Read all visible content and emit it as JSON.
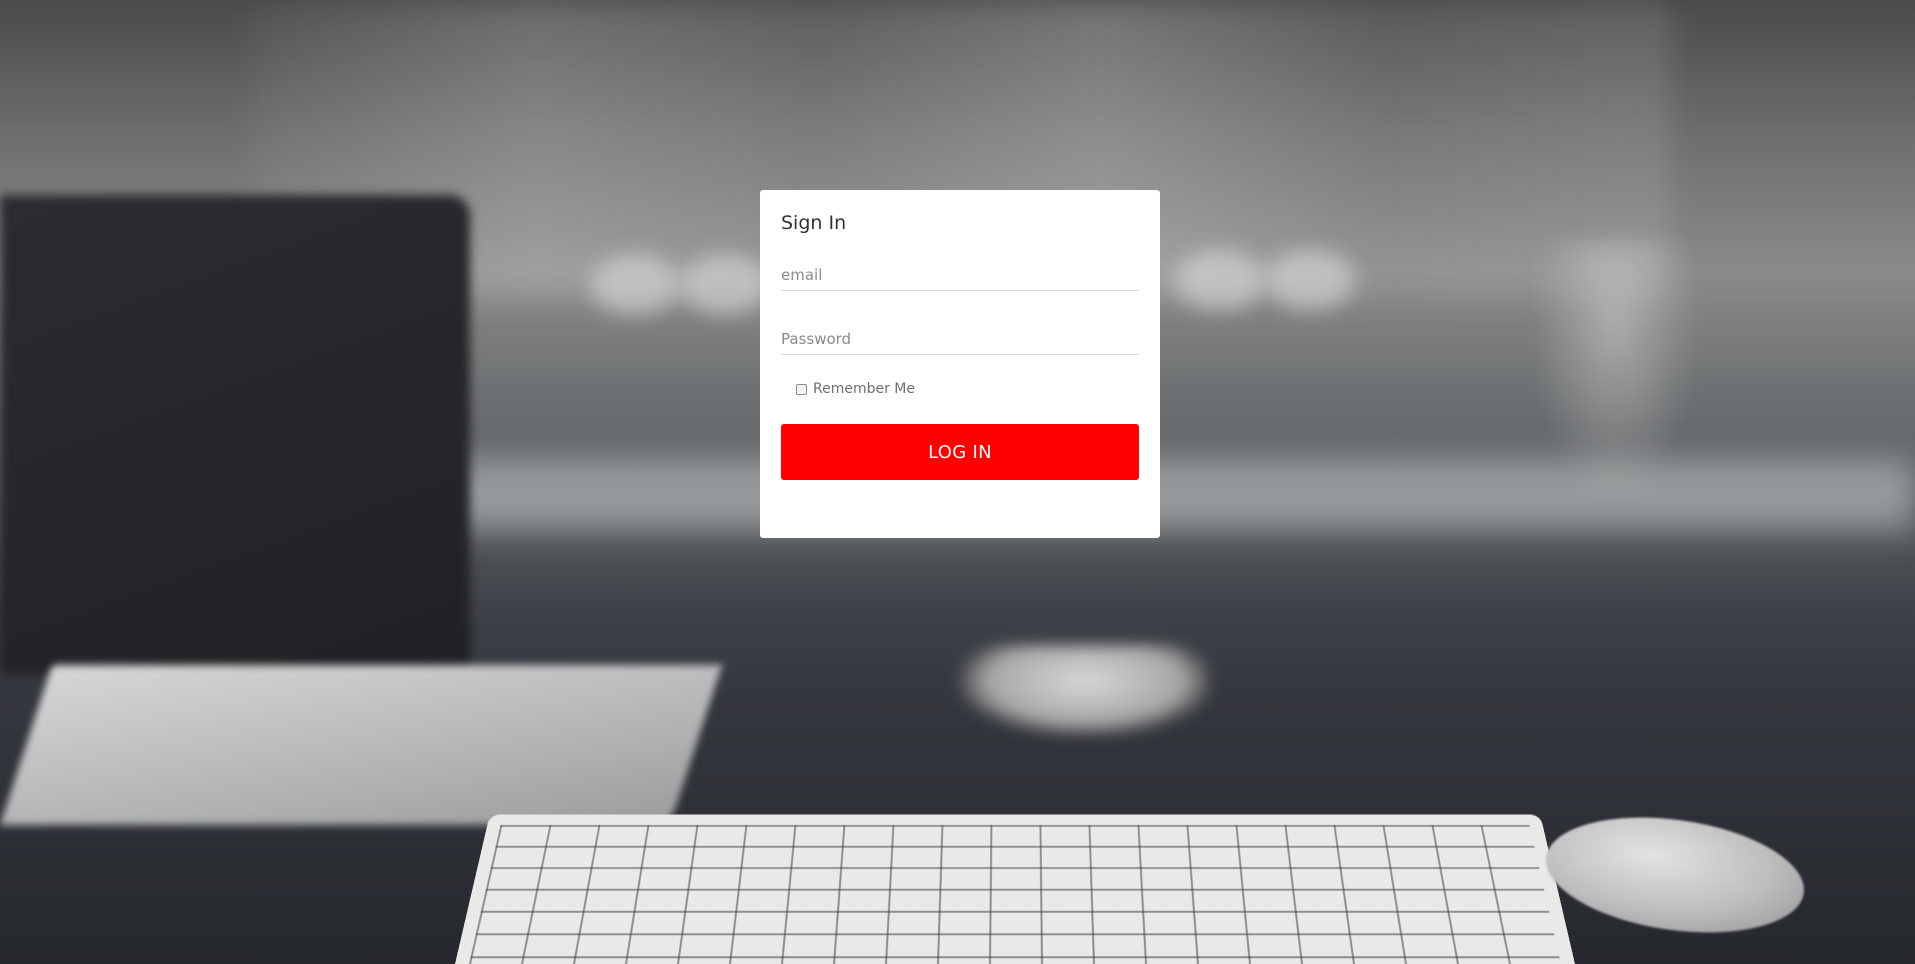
{
  "colors": {
    "accent": "#ff0000",
    "card_background": "#ffffff",
    "title_text": "#333333",
    "placeholder_text": "#8a8a8a"
  },
  "login": {
    "title": "Sign In",
    "email_placeholder": "email",
    "email_value": "",
    "password_placeholder": "Password",
    "password_value": "",
    "remember_label": "Remember Me",
    "remember_checked": false,
    "submit_label": "LOG IN"
  }
}
